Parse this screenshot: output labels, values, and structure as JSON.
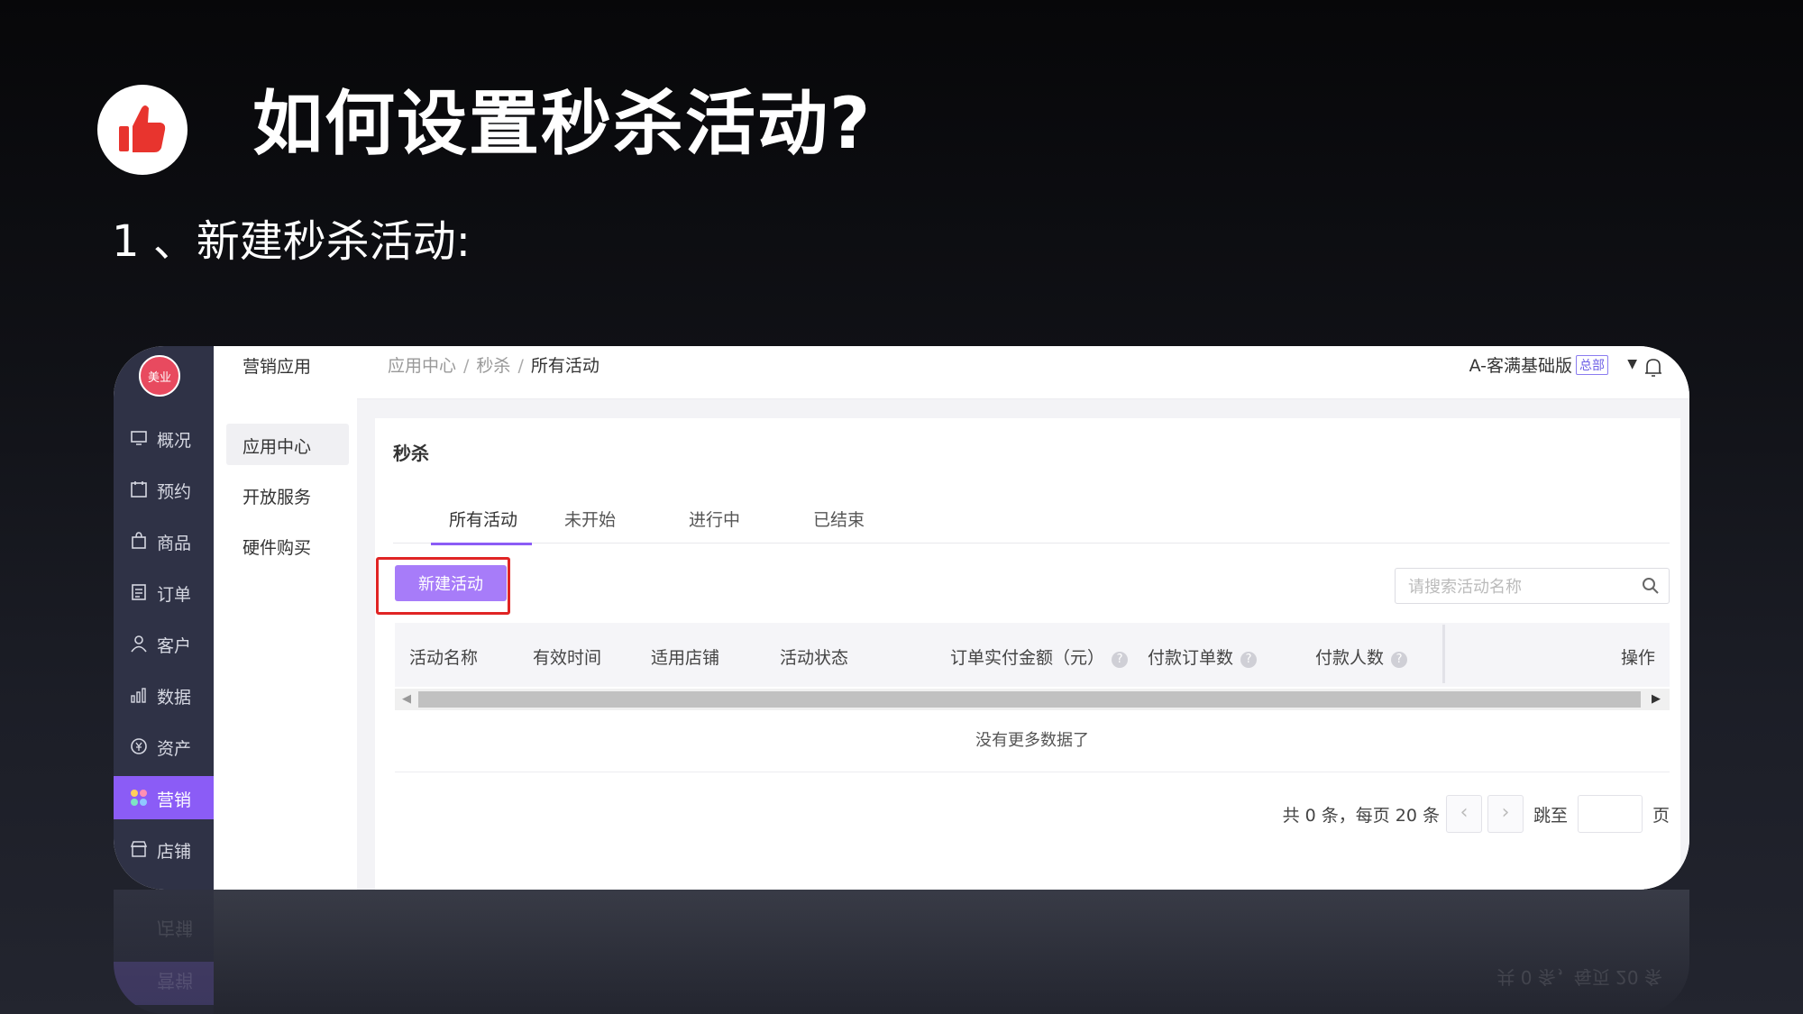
{
  "slide": {
    "title": "如何设置秒杀活动?",
    "step": "1 、新建秒杀活动:"
  },
  "app": {
    "logo_text": "美业",
    "sidebar": {
      "items": [
        {
          "label": "概况",
          "icon": "overview-icon"
        },
        {
          "label": "预约",
          "icon": "calendar-icon"
        },
        {
          "label": "商品",
          "icon": "bag-icon"
        },
        {
          "label": "订单",
          "icon": "order-icon"
        },
        {
          "label": "客户",
          "icon": "user-icon"
        },
        {
          "label": "数据",
          "icon": "bar-chart-icon"
        },
        {
          "label": "资产",
          "icon": "asset-icon"
        },
        {
          "label": "营销",
          "icon": "marketing-icon",
          "active": true
        },
        {
          "label": "店铺",
          "icon": "store-icon"
        }
      ]
    },
    "subnav": {
      "title": "营销应用",
      "items": [
        "应用中心",
        "开放服务",
        "硬件购买"
      ]
    },
    "breadcrumb": [
      "应用中心",
      "秒杀",
      "所有活动"
    ],
    "shop": {
      "name": "A-客满基础版",
      "badge": "总部"
    },
    "page_title": "秒杀",
    "tabs": [
      "所有活动",
      "未开始",
      "进行中",
      "已结束"
    ],
    "new_button": "新建活动",
    "search_placeholder": "请搜索活动名称",
    "table": {
      "columns": [
        "活动名称",
        "有效时间",
        "适用店铺",
        "活动状态",
        "订单实付金额（元）",
        "付款订单数",
        "付款人数",
        "操作"
      ],
      "empty_text": "没有更多数据了"
    },
    "pager": {
      "total_text": "共 0 条，每页 20 条",
      "jump_label": "跳至",
      "page_label": "页"
    },
    "colors": {
      "accent": "#8b5cf6",
      "sidebar_bg": "#2f3246",
      "highlight_box": "#e02424",
      "thumb_icon": "#e8342e"
    }
  }
}
